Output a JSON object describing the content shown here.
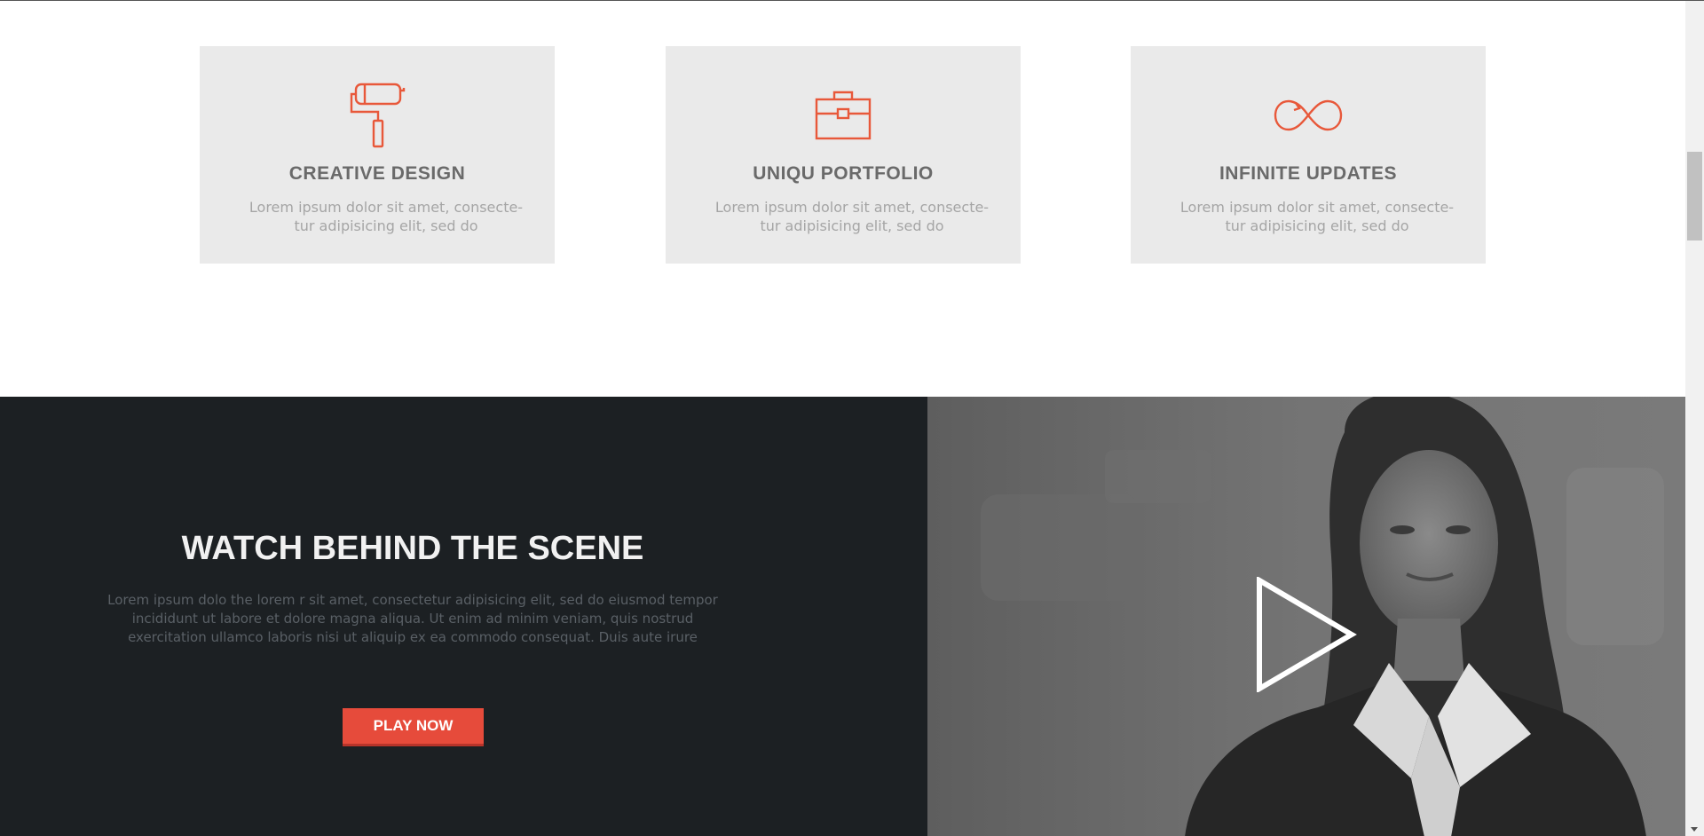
{
  "features": [
    {
      "icon": "paint-roller-icon",
      "title": "CREATIVE DESIGN",
      "text": "Lorem ipsum dolor sit amet, consecte- tur adipisicing elit, sed do"
    },
    {
      "icon": "briefcase-icon",
      "title": "UNIQU PORTFOLIO",
      "text": "Lorem ipsum dolor sit amet, consecte- tur adipisicing elit, sed do"
    },
    {
      "icon": "infinity-icon",
      "title": "INFINITE UPDATES",
      "text": "Lorem ipsum dolor sit amet, consecte- tur adipisicing elit, sed do"
    }
  ],
  "video_section": {
    "title": "WATCH BEHIND THE SCENE",
    "text": "Lorem ipsum dolo the lorem r sit amet, consectetur adipisicing elit, sed do eiusmod tempor incididunt ut labore et dolore magna aliqua. Ut enim ad minim veniam, quis nostrud exercitation ullamco laboris nisi ut aliquip ex ea commodo consequat. Duis aute irure",
    "button_label": "PLAY NOW",
    "play_icon": "play-icon",
    "image": "woman-portrait-photo"
  },
  "colors": {
    "accent": "#e64b3b",
    "icon_orange": "#e8583a",
    "card_bg": "#eaeaea",
    "dark_bg": "#1c2023",
    "heading_gray": "#6a6a6a"
  }
}
